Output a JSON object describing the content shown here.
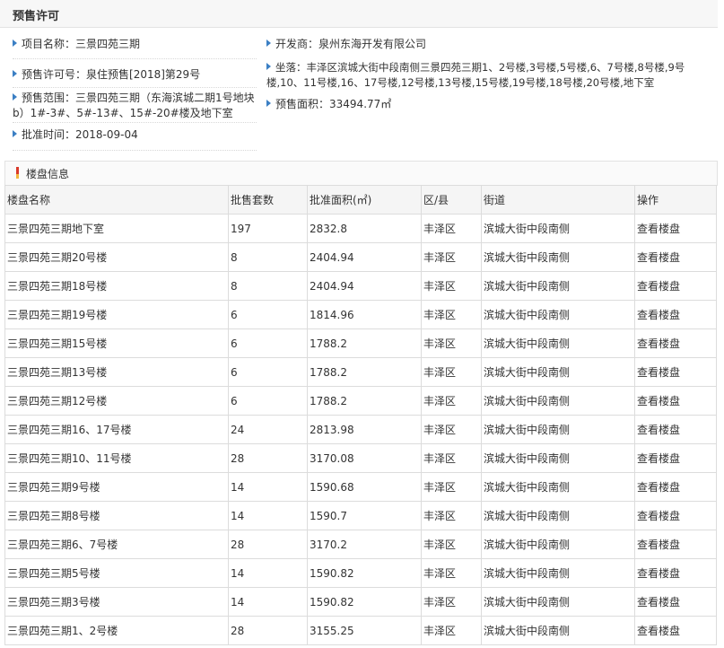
{
  "header": {
    "title": "预售许可"
  },
  "permit": {
    "project_name_label": "项目名称：",
    "project_name": "三景四苑三期",
    "developer_label": "开发商：",
    "developer": "泉州东海开发有限公司",
    "license_no_label": "预售许可号：",
    "license_no": "泉住预售[2018]第29号",
    "location_label": "坐落：",
    "location_line1": "丰泽区滨城大街中段南侧三景四苑三期1、2号楼,3号楼,5号楼,6、7号楼,8号楼,9号",
    "location_line2": "楼,10、11号楼,16、17号楼,12号楼,13号楼,15号楼,19号楼,18号楼,20号楼,地下室",
    "scope_label": "预售范围：",
    "scope_line1": "三景四苑三期（东海滨城二期1号地块",
    "scope_line2": "b）1#-3#、5#-13#、15#-20#楼及地下室",
    "area_label": "预售面积：",
    "area": "33494.77㎡",
    "date_label": "批准时间：",
    "date": "2018-09-04"
  },
  "section": {
    "title": "楼盘信息"
  },
  "table": {
    "headers": [
      "楼盘名称",
      "批售套数",
      "批准面积(㎡)",
      "区/县",
      "街道",
      "操作"
    ],
    "rows": [
      [
        "三景四苑三期地下室",
        "197",
        "2832.8",
        "丰泽区",
        "滨城大街中段南侧",
        "查看楼盘"
      ],
      [
        "三景四苑三期20号楼",
        "8",
        "2404.94",
        "丰泽区",
        "滨城大街中段南侧",
        "查看楼盘"
      ],
      [
        "三景四苑三期18号楼",
        "8",
        "2404.94",
        "丰泽区",
        "滨城大街中段南侧",
        "查看楼盘"
      ],
      [
        "三景四苑三期19号楼",
        "6",
        "1814.96",
        "丰泽区",
        "滨城大街中段南侧",
        "查看楼盘"
      ],
      [
        "三景四苑三期15号楼",
        "6",
        "1788.2",
        "丰泽区",
        "滨城大街中段南侧",
        "查看楼盘"
      ],
      [
        "三景四苑三期13号楼",
        "6",
        "1788.2",
        "丰泽区",
        "滨城大街中段南侧",
        "查看楼盘"
      ],
      [
        "三景四苑三期12号楼",
        "6",
        "1788.2",
        "丰泽区",
        "滨城大街中段南侧",
        "查看楼盘"
      ],
      [
        "三景四苑三期16、17号楼",
        "24",
        "2813.98",
        "丰泽区",
        "滨城大街中段南侧",
        "查看楼盘"
      ],
      [
        "三景四苑三期10、11号楼",
        "28",
        "3170.08",
        "丰泽区",
        "滨城大街中段南侧",
        "查看楼盘"
      ],
      [
        "三景四苑三期9号楼",
        "14",
        "1590.68",
        "丰泽区",
        "滨城大街中段南侧",
        "查看楼盘"
      ],
      [
        "三景四苑三期8号楼",
        "14",
        "1590.7",
        "丰泽区",
        "滨城大街中段南侧",
        "查看楼盘"
      ],
      [
        "三景四苑三期6、7号楼",
        "28",
        "3170.2",
        "丰泽区",
        "滨城大街中段南侧",
        "查看楼盘"
      ],
      [
        "三景四苑三期5号楼",
        "14",
        "1590.82",
        "丰泽区",
        "滨城大街中段南侧",
        "查看楼盘"
      ],
      [
        "三景四苑三期3号楼",
        "14",
        "1590.82",
        "丰泽区",
        "滨城大街中段南侧",
        "查看楼盘"
      ],
      [
        "三景四苑三期1、2号楼",
        "28",
        "3155.25",
        "丰泽区",
        "滨城大街中段南侧",
        "查看楼盘"
      ]
    ]
  }
}
